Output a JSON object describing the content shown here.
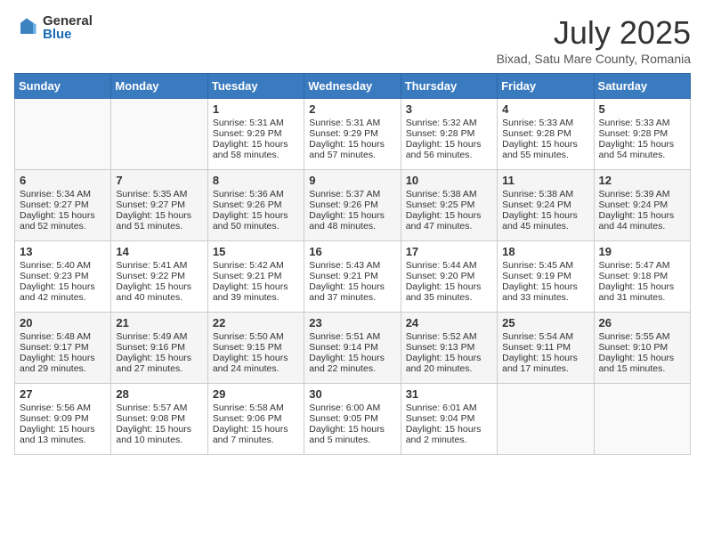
{
  "header": {
    "logo_general": "General",
    "logo_blue": "Blue",
    "month_year": "July 2025",
    "location": "Bixad, Satu Mare County, Romania"
  },
  "days_of_week": [
    "Sunday",
    "Monday",
    "Tuesday",
    "Wednesday",
    "Thursday",
    "Friday",
    "Saturday"
  ],
  "weeks": [
    [
      {
        "day": "",
        "info": ""
      },
      {
        "day": "",
        "info": ""
      },
      {
        "day": "1",
        "info": "Sunrise: 5:31 AM\nSunset: 9:29 PM\nDaylight: 15 hours and 58 minutes."
      },
      {
        "day": "2",
        "info": "Sunrise: 5:31 AM\nSunset: 9:29 PM\nDaylight: 15 hours and 57 minutes."
      },
      {
        "day": "3",
        "info": "Sunrise: 5:32 AM\nSunset: 9:28 PM\nDaylight: 15 hours and 56 minutes."
      },
      {
        "day": "4",
        "info": "Sunrise: 5:33 AM\nSunset: 9:28 PM\nDaylight: 15 hours and 55 minutes."
      },
      {
        "day": "5",
        "info": "Sunrise: 5:33 AM\nSunset: 9:28 PM\nDaylight: 15 hours and 54 minutes."
      }
    ],
    [
      {
        "day": "6",
        "info": "Sunrise: 5:34 AM\nSunset: 9:27 PM\nDaylight: 15 hours and 52 minutes."
      },
      {
        "day": "7",
        "info": "Sunrise: 5:35 AM\nSunset: 9:27 PM\nDaylight: 15 hours and 51 minutes."
      },
      {
        "day": "8",
        "info": "Sunrise: 5:36 AM\nSunset: 9:26 PM\nDaylight: 15 hours and 50 minutes."
      },
      {
        "day": "9",
        "info": "Sunrise: 5:37 AM\nSunset: 9:26 PM\nDaylight: 15 hours and 48 minutes."
      },
      {
        "day": "10",
        "info": "Sunrise: 5:38 AM\nSunset: 9:25 PM\nDaylight: 15 hours and 47 minutes."
      },
      {
        "day": "11",
        "info": "Sunrise: 5:38 AM\nSunset: 9:24 PM\nDaylight: 15 hours and 45 minutes."
      },
      {
        "day": "12",
        "info": "Sunrise: 5:39 AM\nSunset: 9:24 PM\nDaylight: 15 hours and 44 minutes."
      }
    ],
    [
      {
        "day": "13",
        "info": "Sunrise: 5:40 AM\nSunset: 9:23 PM\nDaylight: 15 hours and 42 minutes."
      },
      {
        "day": "14",
        "info": "Sunrise: 5:41 AM\nSunset: 9:22 PM\nDaylight: 15 hours and 40 minutes."
      },
      {
        "day": "15",
        "info": "Sunrise: 5:42 AM\nSunset: 9:21 PM\nDaylight: 15 hours and 39 minutes."
      },
      {
        "day": "16",
        "info": "Sunrise: 5:43 AM\nSunset: 9:21 PM\nDaylight: 15 hours and 37 minutes."
      },
      {
        "day": "17",
        "info": "Sunrise: 5:44 AM\nSunset: 9:20 PM\nDaylight: 15 hours and 35 minutes."
      },
      {
        "day": "18",
        "info": "Sunrise: 5:45 AM\nSunset: 9:19 PM\nDaylight: 15 hours and 33 minutes."
      },
      {
        "day": "19",
        "info": "Sunrise: 5:47 AM\nSunset: 9:18 PM\nDaylight: 15 hours and 31 minutes."
      }
    ],
    [
      {
        "day": "20",
        "info": "Sunrise: 5:48 AM\nSunset: 9:17 PM\nDaylight: 15 hours and 29 minutes."
      },
      {
        "day": "21",
        "info": "Sunrise: 5:49 AM\nSunset: 9:16 PM\nDaylight: 15 hours and 27 minutes."
      },
      {
        "day": "22",
        "info": "Sunrise: 5:50 AM\nSunset: 9:15 PM\nDaylight: 15 hours and 24 minutes."
      },
      {
        "day": "23",
        "info": "Sunrise: 5:51 AM\nSunset: 9:14 PM\nDaylight: 15 hours and 22 minutes."
      },
      {
        "day": "24",
        "info": "Sunrise: 5:52 AM\nSunset: 9:13 PM\nDaylight: 15 hours and 20 minutes."
      },
      {
        "day": "25",
        "info": "Sunrise: 5:54 AM\nSunset: 9:11 PM\nDaylight: 15 hours and 17 minutes."
      },
      {
        "day": "26",
        "info": "Sunrise: 5:55 AM\nSunset: 9:10 PM\nDaylight: 15 hours and 15 minutes."
      }
    ],
    [
      {
        "day": "27",
        "info": "Sunrise: 5:56 AM\nSunset: 9:09 PM\nDaylight: 15 hours and 13 minutes."
      },
      {
        "day": "28",
        "info": "Sunrise: 5:57 AM\nSunset: 9:08 PM\nDaylight: 15 hours and 10 minutes."
      },
      {
        "day": "29",
        "info": "Sunrise: 5:58 AM\nSunset: 9:06 PM\nDaylight: 15 hours and 7 minutes."
      },
      {
        "day": "30",
        "info": "Sunrise: 6:00 AM\nSunset: 9:05 PM\nDaylight: 15 hours and 5 minutes."
      },
      {
        "day": "31",
        "info": "Sunrise: 6:01 AM\nSunset: 9:04 PM\nDaylight: 15 hours and 2 minutes."
      },
      {
        "day": "",
        "info": ""
      },
      {
        "day": "",
        "info": ""
      }
    ]
  ]
}
